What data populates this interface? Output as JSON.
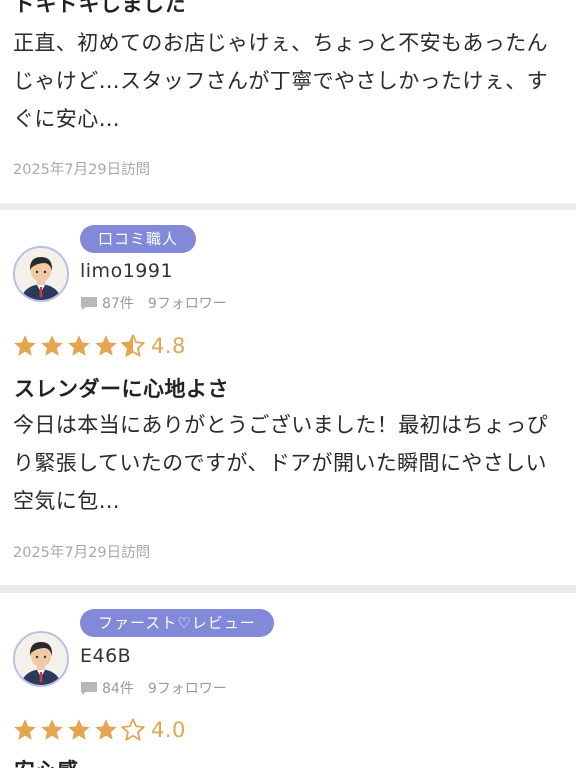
{
  "reviews": [
    {
      "title": "ドキドキしました",
      "body": "正直、初めてのお店じゃけぇ、ちょっと不安もあったんじゃけど…スタッフさんが丁寧でやさしかったけぇ、すぐに安心…",
      "visit_date": "2025年7月29日訪問"
    },
    {
      "badge": "口コミ職人",
      "avatar_icon": "user-avatar-icon",
      "username": "limo1991",
      "post_count": "87件",
      "followers": "9フォロワー",
      "rating": 4.8,
      "rating_text": "4.8",
      "title": "スレンダーに心地よさ",
      "body": "今日は本当にありがとうございました！最初はちょっぴり緊張していたのですが、ドアが開いた瞬間にやさしい空気に包…",
      "visit_date": "2025年7月29日訪問"
    },
    {
      "badge": "ファースト♡レビュー",
      "avatar_icon": "user-avatar-icon",
      "username": "E46B",
      "post_count": "84件",
      "followers": "9フォロワー",
      "rating": 4.0,
      "rating_text": "4.0",
      "title": "安心感"
    }
  ],
  "colors": {
    "accent_badge": "#8189d8",
    "star_filled": "#e3a550",
    "meta_text": "#a8a8a8",
    "background": "#ececec"
  },
  "icons": {
    "comment": "comment-bubble-icon",
    "star": "star-icon",
    "star_half": "star-half-icon",
    "star_empty": "star-empty-icon"
  }
}
